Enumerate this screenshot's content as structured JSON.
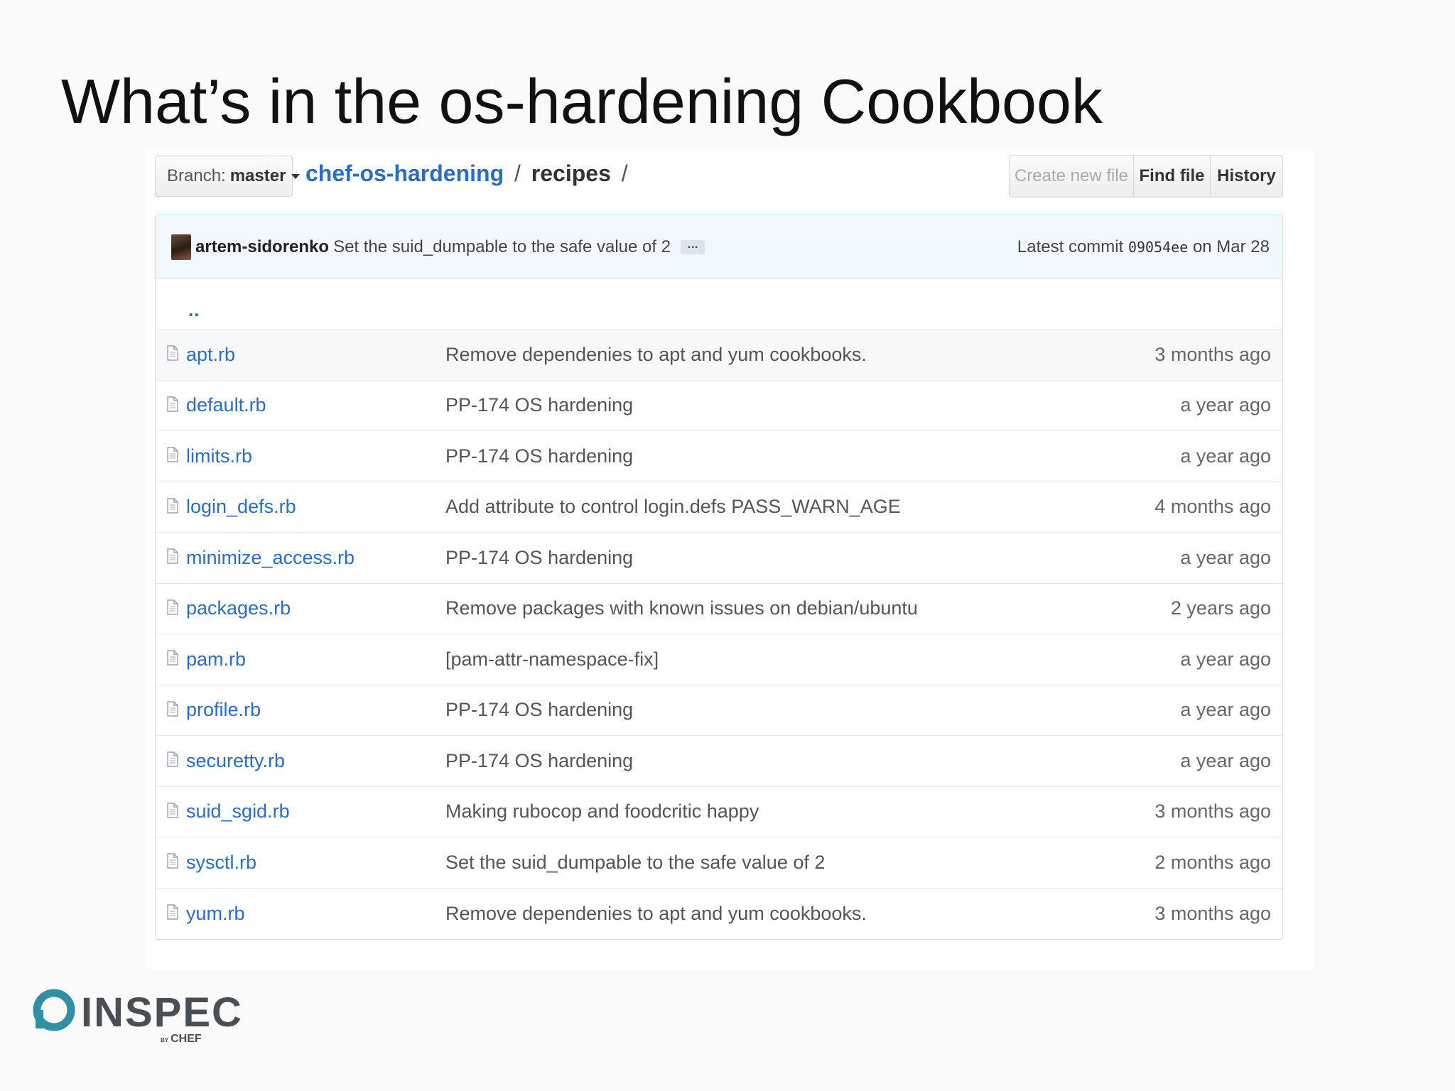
{
  "slide": {
    "title": "What’s in the os-hardening Cookbook"
  },
  "topbar": {
    "branch_label": "Branch:",
    "branch_value": "master",
    "repo": "chef-os-hardening",
    "separator": "/",
    "directory": "recipes",
    "trailing_separator": "/",
    "create_new_file": "Create new file",
    "find_file": "Find file",
    "history": "History"
  },
  "commit": {
    "author": "artem-sidorenko",
    "message": "Set the suid_dumpable to the safe value of 2",
    "ellipsis": "…",
    "latest_label": "Latest commit",
    "sha": "09054ee",
    "date_text": "on Mar 28"
  },
  "parent_dir": "..",
  "files": [
    {
      "name": "apt.rb",
      "message": "Remove dependenies to apt and yum cookbooks.",
      "age": "3 months ago"
    },
    {
      "name": "default.rb",
      "message": "PP-174 OS hardening",
      "age": "a year ago"
    },
    {
      "name": "limits.rb",
      "message": "PP-174 OS hardening",
      "age": "a year ago"
    },
    {
      "name": "login_defs.rb",
      "message": "Add attribute to control login.defs PASS_WARN_AGE",
      "age": "4 months ago"
    },
    {
      "name": "minimize_access.rb",
      "message": "PP-174 OS hardening",
      "age": "a year ago"
    },
    {
      "name": "packages.rb",
      "message": "Remove packages with known issues on debian/ubuntu",
      "age": "2 years ago"
    },
    {
      "name": "pam.rb",
      "message": "[pam-attr-namespace-fix]",
      "age": "a year ago"
    },
    {
      "name": "profile.rb",
      "message": "PP-174 OS hardening",
      "age": "a year ago"
    },
    {
      "name": "securetty.rb",
      "message": "PP-174 OS hardening",
      "age": "a year ago"
    },
    {
      "name": "suid_sgid.rb",
      "message": "Making rubocop and foodcritic happy",
      "age": "3 months ago"
    },
    {
      "name": "sysctl.rb",
      "message": "Set the suid_dumpable to the safe value of 2",
      "age": "2 months ago"
    },
    {
      "name": "yum.rb",
      "message": "Remove dependenies to apt and yum cookbooks.",
      "age": "3 months ago"
    }
  ],
  "logo": {
    "text": "INSPEC",
    "by": "BY",
    "sub": "CHEF"
  },
  "colors": {
    "link": "#2b6cc4",
    "commit_bar_bg": "#f1f8ff",
    "logo_teal": "#2f8fa6"
  }
}
